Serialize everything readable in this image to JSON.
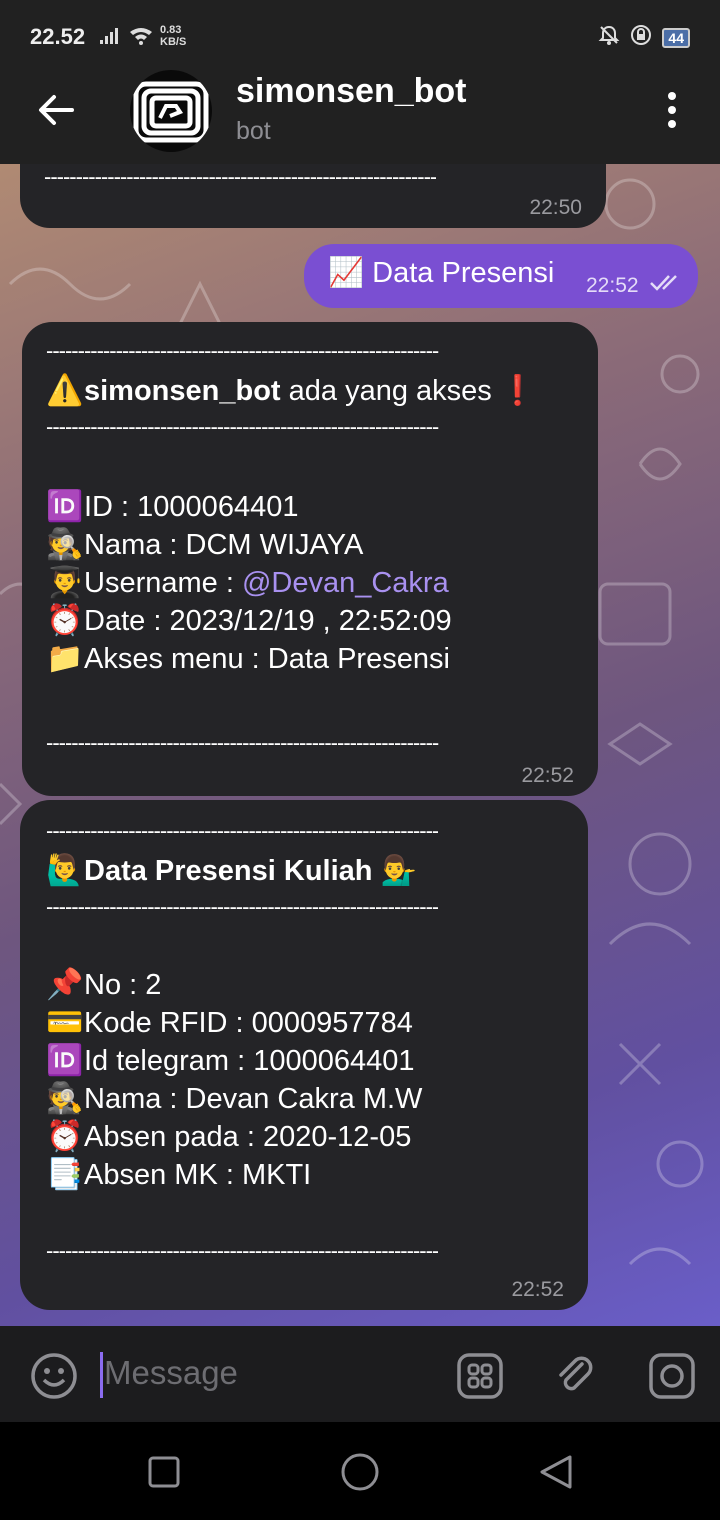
{
  "status_bar": {
    "time": "22.52",
    "speed_value": "0.83",
    "speed_unit": "KB/S",
    "battery": "44"
  },
  "header": {
    "title": "simonsen_bot",
    "subtitle": "bot"
  },
  "messages": {
    "top": {
      "dashes": "--------------------------------------------------------------",
      "time": "22:50"
    },
    "outgoing": {
      "emoji": "📈",
      "text": "Data Presensi",
      "time": "22:52"
    },
    "access": {
      "dashes": "--------------------------------------------------------------",
      "header_emoji": "⚠️",
      "bot_name": "simonsen_bot",
      "header_text": " ada yang akses ",
      "header_end_emoji": "❗",
      "rows": [
        {
          "emoji": "🆔",
          "label": "ID : ",
          "value": "1000064401"
        },
        {
          "emoji": "🕵️",
          "label": "Nama : ",
          "value": "DCM WIJAYA"
        },
        {
          "emoji": "👨‍🎓",
          "label": "Username : ",
          "value": "@Devan_Cakra"
        },
        {
          "emoji": "⏰",
          "label": "Date : ",
          "value": "2023/12/19 , 22:52:09"
        },
        {
          "emoji": "📁",
          "label": "Akses menu : ",
          "value": "Data Presensi"
        }
      ],
      "time": "22:52"
    },
    "attendance": {
      "dashes": "--------------------------------------------------------------",
      "header_emoji": "🙋‍♂️",
      "header_text": "Data Presensi Kuliah",
      "header_end_emoji": "💁‍♂️",
      "rows": [
        {
          "emoji": "📌",
          "label": "No : ",
          "value": "2"
        },
        {
          "emoji": "💳",
          "label": "Kode RFID : ",
          "value": "0000957784"
        },
        {
          "emoji": "🆔",
          "label": "Id telegram : ",
          "value": "1000064401"
        },
        {
          "emoji": "🕵️",
          "label": "Nama : ",
          "value": "Devan Cakra M.W"
        },
        {
          "emoji": "⏰",
          "label": "Absen pada : ",
          "value": "2020-12-05"
        },
        {
          "emoji": "📑",
          "label": "Absen MK : ",
          "value": "MKTI"
        }
      ],
      "time": "22:52"
    }
  },
  "composer": {
    "placeholder": "Message"
  },
  "colors": {
    "bar": "#212121",
    "bubble_incoming": "#242427",
    "bubble_outgoing": "#7a4fd2",
    "link": "#a991f0"
  }
}
